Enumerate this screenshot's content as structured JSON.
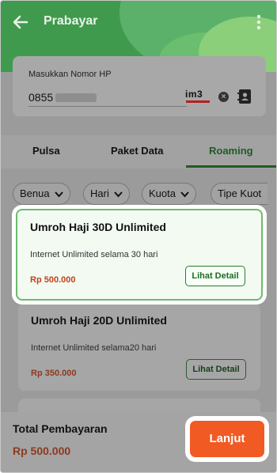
{
  "header": {
    "title": "Prabayar",
    "back_icon": "arrow-left-icon",
    "menu_icon": "more-vertical-icon"
  },
  "phone": {
    "label": "Masukkan Nomor HP",
    "prefix": "0855",
    "brand": "im3",
    "clear_icon": "clear-icon",
    "contact_icon": "contact-book-icon"
  },
  "tabs": [
    "Pulsa",
    "Paket Data",
    "Roaming"
  ],
  "active_tab": "Roaming",
  "filters": [
    "Benua",
    "Hari",
    "Kuota",
    "Tipe Kuot"
  ],
  "packages": [
    {
      "name": "Umroh Haji 30D Unlimited",
      "desc": "Internet Unlimited selama 30 hari",
      "price": "Rp 500.000",
      "detail": "Lihat Detail"
    },
    {
      "name": "Umroh Haji 20D Unlimited",
      "desc": "Internet Unlimited selama20 hari",
      "price": "Rp 350.000",
      "detail": "Lihat Detail"
    }
  ],
  "footer": {
    "total_label": "Total Pembayaran",
    "total_value": "Rp 500.000",
    "next_label": "Lanjut"
  },
  "colors": {
    "header_green": "#3f9a4e",
    "accent_orange": "#f15a22",
    "selected_border": "#6cbc6a",
    "price_red": "#c2421a"
  }
}
